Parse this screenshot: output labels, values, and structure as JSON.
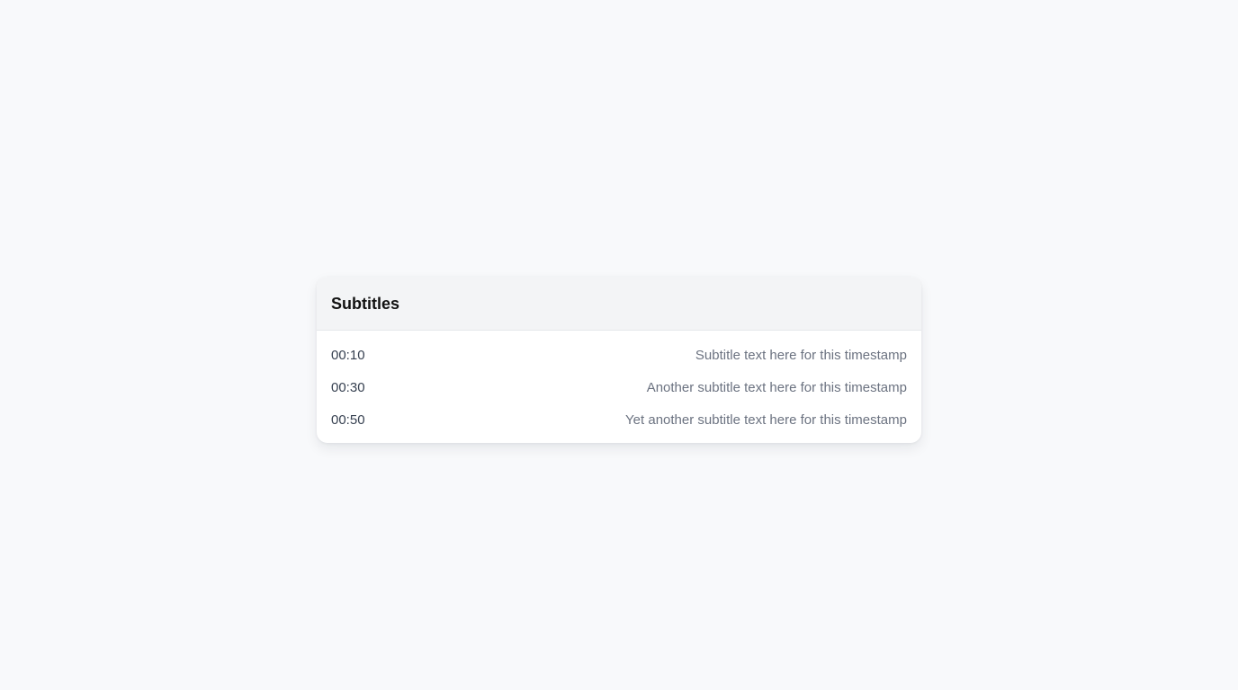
{
  "panel": {
    "title": "Subtitles",
    "items": [
      {
        "time": "00:10",
        "text": "Subtitle text here for this timestamp"
      },
      {
        "time": "00:30",
        "text": "Another subtitle text here for this timestamp"
      },
      {
        "time": "00:50",
        "text": "Yet another subtitle text here for this timestamp"
      }
    ]
  },
  "colors": {
    "page_background": "#f8f9fb",
    "header_background": "#f3f4f6",
    "timestamp_text": "#374151",
    "subtitle_text": "#6b7280"
  }
}
